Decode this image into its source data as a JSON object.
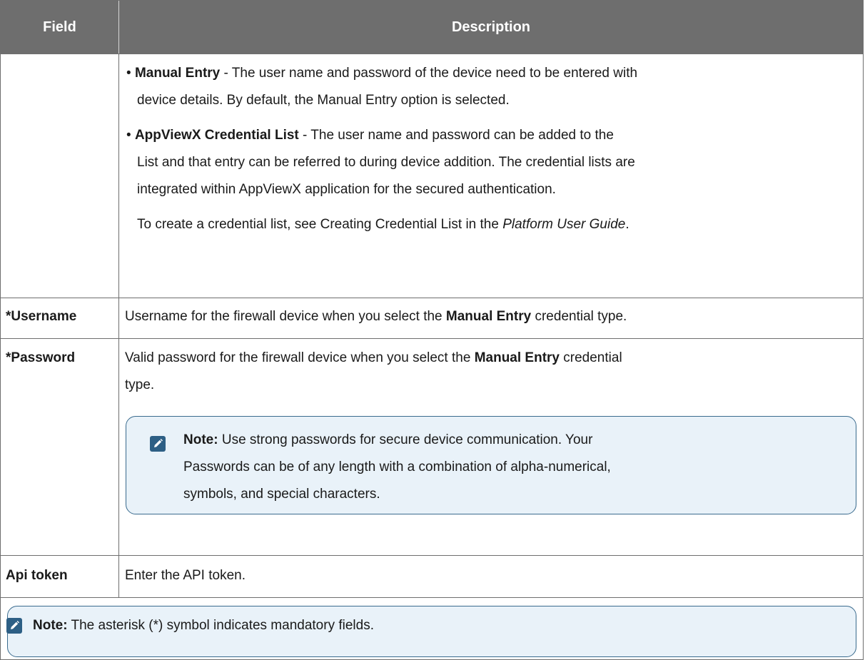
{
  "table": {
    "headers": {
      "field": "Field",
      "description": "Description"
    },
    "credential_row": {
      "bullet1_title": "Manual Entry",
      "bullet1_text": " - The user name and password of the device need to be entered with",
      "bullet1_cont": "device details. By default, the Manual Entry option is selected.",
      "bullet2_title": "AppViewX Credential List",
      "bullet2_text": " - The user name and password can be added to the",
      "bullet2_line2": "List and that entry can be referred to during device addition. The credential lists are",
      "bullet2_line3": "integrated within AppViewX application for the secured authentication.",
      "create_text": "To create a credential list, see Creating Credential List in the ",
      "create_italic": "Platform User Guide",
      "create_end": "."
    },
    "username_row": {
      "field": "*Username",
      "text_before": "Username for the firewall device when you select the ",
      "text_bold": "Manual Entry",
      "text_after": " credential type."
    },
    "password_row": {
      "field": "*Password",
      "text_before": "Valid password for the firewall device when you select the ",
      "text_bold": "Manual Entry",
      "text_after": " credential",
      "text_line2": "type.",
      "note_label": "Note:",
      "note_line1": " Use strong passwords for secure device communication. Your",
      "note_line2": "Passwords can be of any length with a combination of alpha-numerical,",
      "note_line3": "symbols, and special characters."
    },
    "api_row": {
      "field": "Api token",
      "text": "Enter the API token."
    }
  },
  "footer_note": {
    "label": "Note:",
    "text": " The asterisk (*) symbol indicates mandatory fields."
  },
  "icons": {
    "note": "pencil-note-icon"
  },
  "colors": {
    "header_bg": "#6e6e6e",
    "note_bg": "#e9f2f9",
    "note_border": "#3a6b8e",
    "icon_bg": "#2d5f85"
  }
}
